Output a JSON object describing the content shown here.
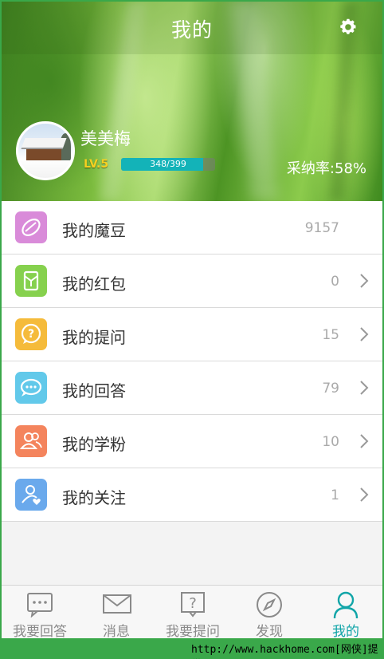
{
  "header": {
    "title": "我的"
  },
  "profile": {
    "name": "美美梅",
    "level": "LV.5",
    "progress_text": "348/399",
    "progress": 0.872,
    "rate": "采纳率:58%"
  },
  "menu": [
    {
      "label": "我的魔豆",
      "count": "9157",
      "icon": "bean-icon",
      "color": "#d98bd9"
    },
    {
      "label": "我的红包",
      "count": "0",
      "icon": "red-packet-icon",
      "color": "#86d14e"
    },
    {
      "label": "我的提问",
      "count": "15",
      "icon": "question-bubble-icon",
      "color": "#f5bb3b"
    },
    {
      "label": "我的回答",
      "count": "79",
      "icon": "answer-bubble-icon",
      "color": "#62c9ea"
    },
    {
      "label": "我的学粉",
      "count": "10",
      "icon": "followers-icon",
      "color": "#f4845d"
    },
    {
      "label": "我的关注",
      "count": "1",
      "icon": "following-icon",
      "color": "#6aa9ec"
    }
  ],
  "tabs": [
    {
      "label": "我要回答",
      "icon": "chat-icon"
    },
    {
      "label": "消息",
      "icon": "mail-icon"
    },
    {
      "label": "我要提问",
      "icon": "question-icon"
    },
    {
      "label": "发现",
      "icon": "compass-icon"
    },
    {
      "label": "我的",
      "icon": "person-icon"
    }
  ],
  "watermark": "http://www.hackhome.com[网侠]提供",
  "colors": {
    "accent": "#11a5a8",
    "inactive": "#8a8a8a"
  }
}
